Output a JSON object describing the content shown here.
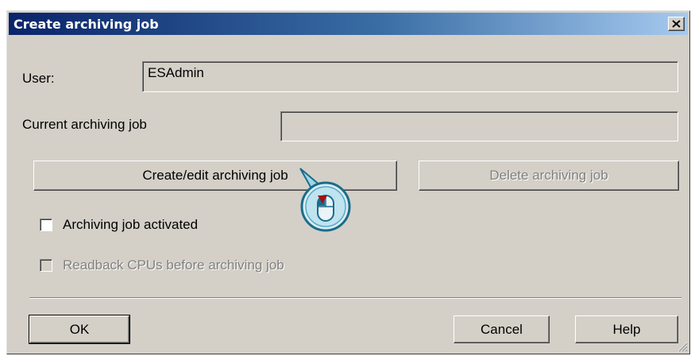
{
  "dialog": {
    "title": "Create archiving job",
    "close_glyph": "×"
  },
  "user": {
    "label": "User:",
    "value": "ESAdmin"
  },
  "current_job": {
    "label": "Current archiving job",
    "value": ""
  },
  "buttons": {
    "create_edit": "Create/edit archiving job",
    "delete": "Delete archiving job",
    "ok": "OK",
    "cancel": "Cancel",
    "help": "Help"
  },
  "checkboxes": {
    "activated": {
      "label": "Archiving job activated",
      "checked": false,
      "enabled": true
    },
    "readback": {
      "label": "Readback CPUs before archiving job",
      "checked": false,
      "enabled": false
    }
  },
  "icons": {
    "close": "close-icon",
    "mouse_click": "mouse-click-icon",
    "resize_grip": "resize-grip-icon"
  },
  "colors": {
    "title_start": "#0a246a",
    "title_end": "#a6caf0",
    "face": "#d4d0c8",
    "disabled_text": "#808080",
    "cursor_arrow": "#a01010"
  }
}
